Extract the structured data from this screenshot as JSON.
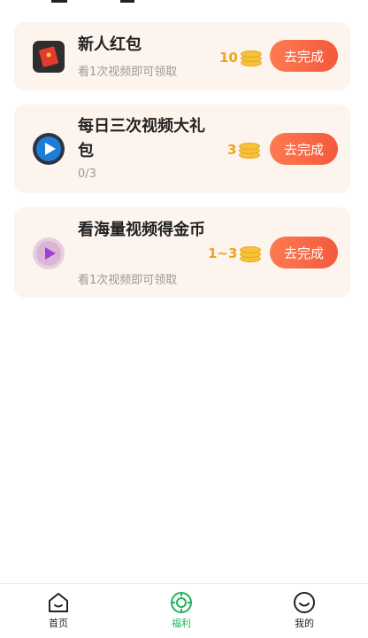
{
  "tasks": [
    {
      "title": "新人红包",
      "subtitle": "看1次视频即可领取",
      "reward": "10",
      "button": "去完成",
      "icon": "red-envelope-icon"
    },
    {
      "title": "每日三次视频大礼包",
      "subtitle": "0/3",
      "reward": "3",
      "button": "去完成",
      "icon": "play-icon"
    },
    {
      "title": "看海量视频得金币",
      "subtitle": "看1次视频即可领取",
      "reward": "1~3",
      "button": "去完成",
      "icon": "video-icon"
    }
  ],
  "tabs": [
    {
      "label": "首页",
      "icon": "home-icon"
    },
    {
      "label": "福利",
      "icon": "welfare-icon",
      "active": true
    },
    {
      "label": "我的",
      "icon": "profile-icon"
    }
  ],
  "colors": {
    "accent": "#f35a3c",
    "coin": "#f0a21a",
    "active_tab": "#20b35a",
    "card_bg": "#fdf4ee"
  }
}
